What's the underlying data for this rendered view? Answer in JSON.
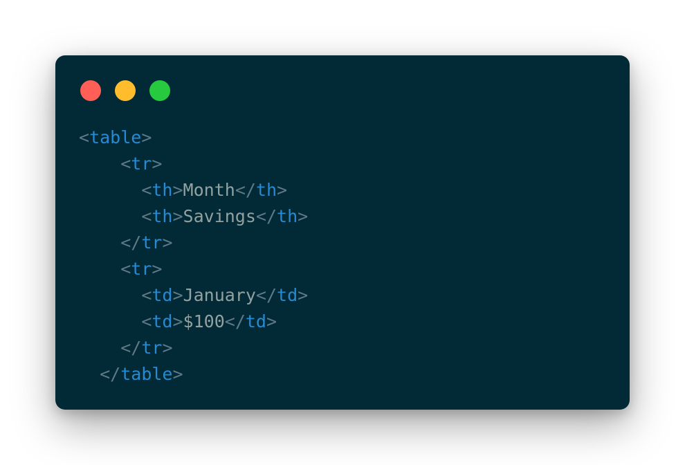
{
  "window": {
    "controls": {
      "close_color": "#ff5f56",
      "minimize_color": "#ffbd2e",
      "maximize_color": "#27c93f"
    },
    "background": "#022a36"
  },
  "code": {
    "colors": {
      "punctuation": "#5f7a85",
      "tag": "#268bd2",
      "text": "#93a1a1"
    },
    "lines": [
      {
        "indent": "",
        "open": "<",
        "tag": "table",
        "close": ">"
      },
      {
        "indent": "    ",
        "open": "<",
        "tag": "tr",
        "close": ">"
      },
      {
        "indent": "      ",
        "open": "<",
        "tag": "th",
        "close": ">",
        "content": "Month",
        "end_open": "</",
        "end_tag": "th",
        "end_close": ">"
      },
      {
        "indent": "      ",
        "open": "<",
        "tag": "th",
        "close": ">",
        "content": "Savings",
        "end_open": "</",
        "end_tag": "th",
        "end_close": ">"
      },
      {
        "indent": "    ",
        "open": "</",
        "tag": "tr",
        "close": ">"
      },
      {
        "indent": "    ",
        "open": "<",
        "tag": "tr",
        "close": ">"
      },
      {
        "indent": "      ",
        "open": "<",
        "tag": "td",
        "close": ">",
        "content": "January",
        "end_open": "</",
        "end_tag": "td",
        "end_close": ">"
      },
      {
        "indent": "      ",
        "open": "<",
        "tag": "td",
        "close": ">",
        "content": "$100",
        "end_open": "</",
        "end_tag": "td",
        "end_close": ">"
      },
      {
        "indent": "    ",
        "open": "</",
        "tag": "tr",
        "close": ">"
      },
      {
        "indent": "  ",
        "open": "</",
        "tag": "table",
        "close": ">"
      }
    ]
  }
}
